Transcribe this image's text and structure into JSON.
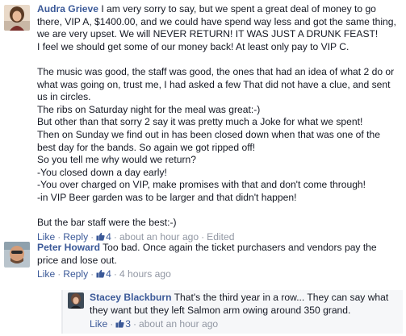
{
  "comments": [
    {
      "author": "Audra Grieve",
      "lines": [
        "I am very sorry to say, but we spent a great deal of money to go",
        "there, VIP A, $1400.00, and we could have spend way less and got the same thing,",
        "we are very upset. We will NEVER RETURN! IT WAS JUST A DRUNK FEAST!",
        "I feel we should get some of our money back! At least only pay to VIP C.",
        "",
        "The music was good, the staff was good, the ones that had an idea of what 2 do or",
        "what was going on, trust me, I had asked a few That did not have a clue, and sent",
        "us in circles.",
        "The ribs on Saturday night for the meal was great:-)",
        "But other than that sorry 2 say it was pretty much a Joke for what we spent!",
        "Then on Sunday we find out in has been closed down when that was one of the",
        "best day for the bands. So again we got ripped off!",
        "So you tell me why would we return?",
        "-You closed down a day early!",
        "-You over charged on VIP, make promises with that and don't come through!",
        "-in VIP Beer garden was to be larger and that didn't happen!",
        "",
        "But the bar staff were the best:-)"
      ],
      "actions": {
        "like": "Like",
        "reply": "Reply",
        "likes": "4",
        "time": "about an hour ago",
        "edited": "Edited"
      }
    },
    {
      "author": "Peter Howard",
      "lines": [
        "Too bad. Once again the ticket purchasers and vendors pay the",
        "price and lose out."
      ],
      "actions": {
        "like": "Like",
        "reply": "Reply",
        "likes": "4",
        "time": "4 hours ago"
      }
    },
    {
      "author": "Stacey Blackburn",
      "lines": [
        "That's the third year in a row... They can say what",
        "they want but they left Salmon arm owing around 350 grand."
      ],
      "actions": {
        "like": "Like",
        "likes": "3",
        "time": "about an hour ago"
      }
    }
  ],
  "separator": "·",
  "colors": {
    "link": "#3b5998",
    "meta": "#9197a3",
    "text": "#141823",
    "reply_bg": "#f6f7f9"
  }
}
